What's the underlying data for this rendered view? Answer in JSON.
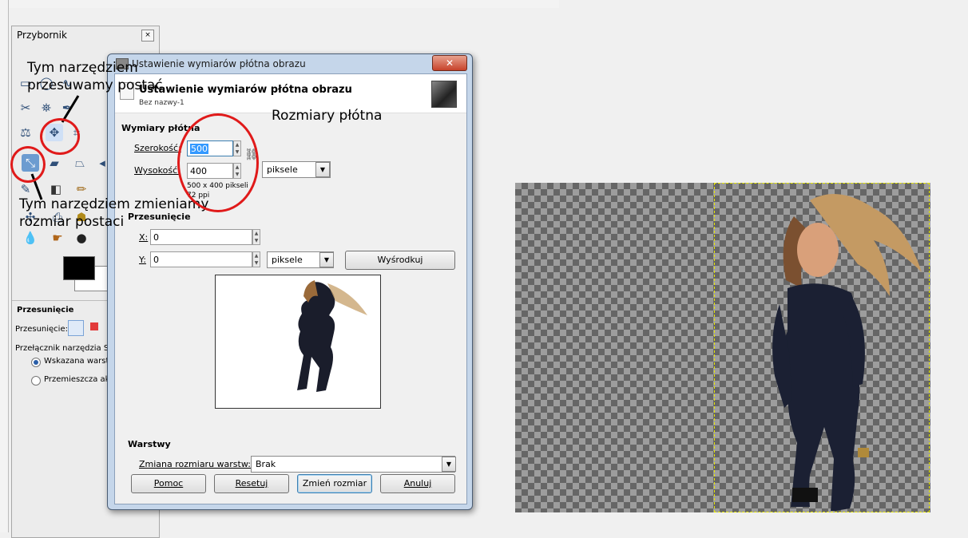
{
  "toolbox": {
    "title": "Przybornik",
    "close_glyph": "×",
    "options_title": "Przesunięcie",
    "move_label": "Przesunięcie:",
    "switch_label": "Przełącznik narzędzia  Sh",
    "radio_1": "Wskazana warstwa",
    "radio_2": "Przemieszcza akty"
  },
  "dialog": {
    "window_title": "Ustawienie wymiarów płótna obrazu",
    "header_title": "Ustawienie wymiarów płótna obrazu",
    "header_subtitle": "Bez nazwy-1",
    "canvas_section": "Wymiary płótna",
    "width_label": "Szerokość:",
    "width_value": "500",
    "height_label": "Wysokość:",
    "height_value": "400",
    "unit": "piksele",
    "size_info": "500 x 400 pikseli",
    "ppi_info": "72 ppi",
    "offset_section": "Przesunięcie",
    "x_label": "X:",
    "x_value": "0",
    "y_label": "Y:",
    "y_value": "0",
    "offset_unit": "piksele",
    "center_button": "Wyśrodkuj",
    "layers_section": "Warstwy",
    "resize_layers_label": "Zmiana rozmiaru warstw:",
    "resize_layers_value": "Brak",
    "buttons": {
      "help": "Pomoc",
      "reset": "Resetuj",
      "resize": "Zmień rozmiar",
      "cancel": "Anuluj"
    }
  },
  "annotations": {
    "move_tool_line1": "Tym narzędziem",
    "move_tool_line2": "przesuwamy postać",
    "scale_tool_line1": "Tym narzędziem zmieniamy",
    "scale_tool_line2": "rozmiar postaci",
    "canvas_size": "Rozmiary płótna"
  },
  "colors": {
    "annotation_ring": "#e01a1a",
    "title_bar": "#c5d6ea",
    "selection": "#e8e800"
  }
}
